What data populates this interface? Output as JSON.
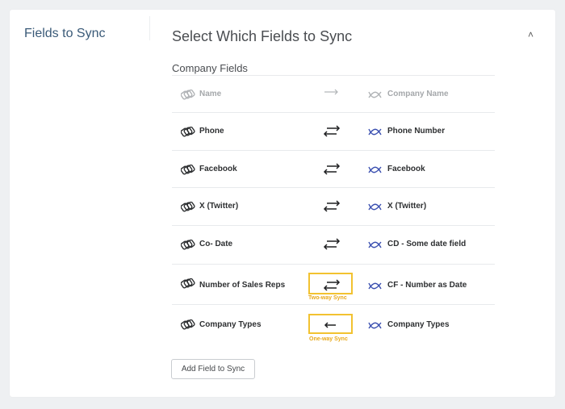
{
  "sidebar": {
    "title": "Fields to Sync"
  },
  "main": {
    "title": "Select Which Fields to Sync",
    "section_title": "Company Fields",
    "add_button_label": "Add Field to Sync"
  },
  "rows": [
    {
      "left": "Name",
      "right": "Company Name",
      "direction": "one-way-right",
      "disabled": true
    },
    {
      "left": "Phone",
      "right": "Phone Number",
      "direction": "two-way",
      "disabled": false
    },
    {
      "left": "Facebook",
      "right": "Facebook",
      "direction": "two-way",
      "disabled": false
    },
    {
      "left": "X (Twitter)",
      "right": "X (Twitter)",
      "direction": "two-way",
      "disabled": false
    },
    {
      "left": "Co- Date",
      "right": "CD - Some date field",
      "direction": "two-way",
      "disabled": false
    },
    {
      "left": "Number of Sales Reps",
      "right": "CF - Number as Date",
      "direction": "two-way",
      "disabled": false
    },
    {
      "left": "Company Types",
      "right": "Company Types",
      "direction": "one-way-left",
      "disabled": false
    }
  ],
  "annotations": {
    "two_way": "Two-way Sync",
    "one_way": "One-way Sync",
    "highlight_color": "#f2c230",
    "label_color": "#e8a818"
  }
}
